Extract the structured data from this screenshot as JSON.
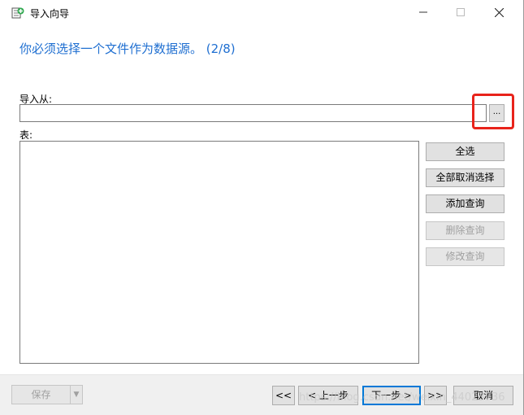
{
  "window": {
    "title": "导入向导",
    "icon": "import-wizard-icon",
    "controls": {
      "minimize": "minimize-icon",
      "maximize": "maximize-icon",
      "close": "close-icon"
    }
  },
  "heading": "你必须选择一个文件作为数据源。 (2/8)",
  "import_from": {
    "label": "导入从:",
    "value": "",
    "browse_label": "..."
  },
  "tables": {
    "label": "表:",
    "items": []
  },
  "side_buttons": {
    "select_all": "全选",
    "deselect_all": "全部取消选择",
    "add_query": "添加查询",
    "delete_query": "删除查询",
    "edit_query": "修改查询"
  },
  "footer": {
    "save": "保存",
    "first": "<<",
    "prev": "< 上一步",
    "next": "下一步 >",
    "last": ">>",
    "cancel": "取消"
  },
  "watermark": "https://blog.csdn.net/weixin_44023736",
  "colors": {
    "heading": "#1f6fd1",
    "highlight": "#e8231b",
    "focus": "#0078d7"
  }
}
